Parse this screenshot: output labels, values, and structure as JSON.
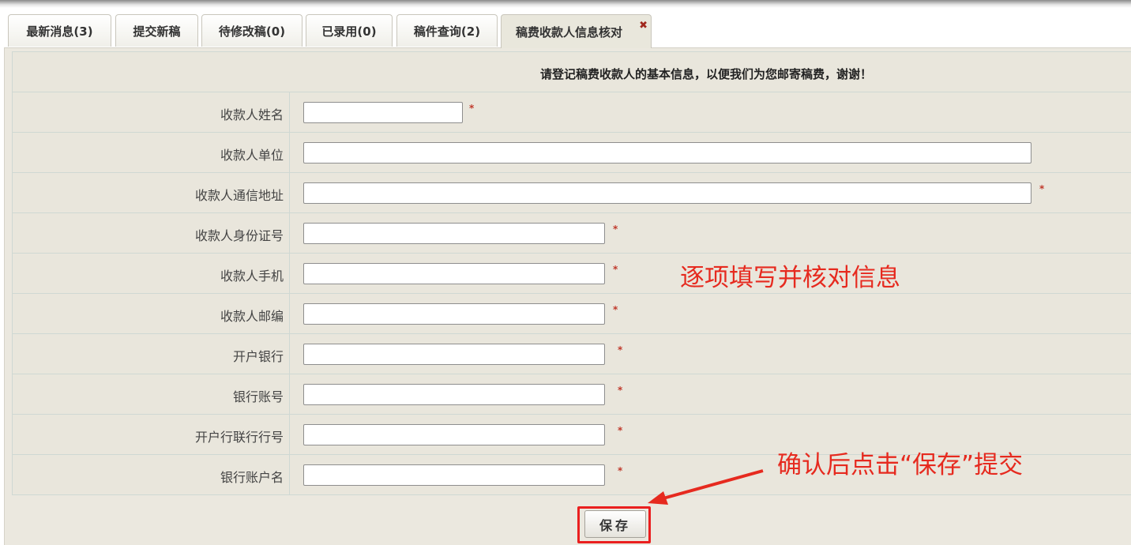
{
  "tabs": [
    {
      "label": "最新消息(3)"
    },
    {
      "label": "提交新稿"
    },
    {
      "label": "待修改稿(0)"
    },
    {
      "label": "已录用(0)"
    },
    {
      "label": "稿件查询(2)"
    },
    {
      "label": "稿费收款人信息核对",
      "active": true,
      "close": "✖"
    }
  ],
  "form": {
    "header": "请登记稿费收款人的基本信息，以便我们为您邮寄稿费，谢谢！",
    "required_mark": "*",
    "fields": [
      {
        "label": "收款人姓名",
        "value": "",
        "required": true
      },
      {
        "label": "收款人单位",
        "value": "",
        "required": false
      },
      {
        "label": "收款人通信地址",
        "value": "",
        "required": true
      },
      {
        "label": "收款人身份证号",
        "value": "",
        "required": true
      },
      {
        "label": "收款人手机",
        "value": "",
        "required": true
      },
      {
        "label": "收款人邮编",
        "value": "",
        "required": true
      },
      {
        "label": "开户银行",
        "value": "",
        "required": true
      },
      {
        "label": "银行账号",
        "value": "",
        "required": true
      },
      {
        "label": "开户行联行行号",
        "value": "",
        "required": true
      },
      {
        "label": "银行账户名",
        "value": "",
        "required": true
      }
    ],
    "save_label": "保存"
  },
  "annotations": {
    "fill_hint": "逐项填写并核对信息",
    "save_hint": "确认后点击“保存”提交",
    "color": "#e62a1f"
  }
}
